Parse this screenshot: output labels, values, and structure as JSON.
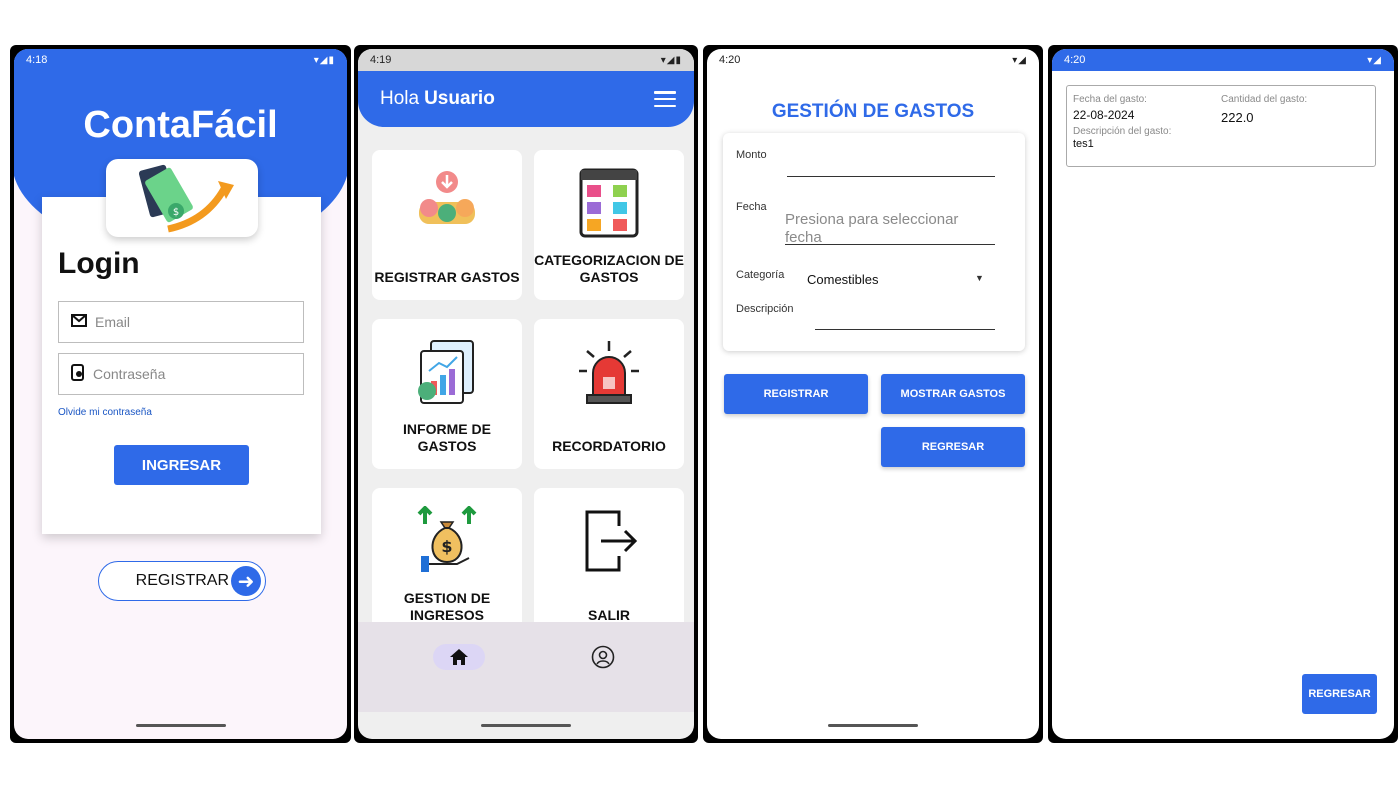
{
  "colors": {
    "primary": "#2f6ae8",
    "background": "#fcf5fb"
  },
  "login_screen": {
    "status_time": "4:18",
    "brand": "ContaFácil",
    "title": "Login",
    "email_placeholder": "Email",
    "password_placeholder": "Contraseña",
    "forgot_password": "Olvide mi contraseña",
    "login_button": "INGRESAR",
    "register_button": "REGISTRAR"
  },
  "menu_screen": {
    "status_time": "4:19",
    "greeting": "Hola",
    "user": "Usuario",
    "tiles": [
      {
        "label": "REGISTRAR GASTOS",
        "icon": "money-coins-icon"
      },
      {
        "label": "CATEGORIZACION DE GASTOS",
        "icon": "categories-board-icon"
      },
      {
        "label": "INFORME DE GASTOS",
        "icon": "report-chart-icon"
      },
      {
        "label": "RECORDATORIO",
        "icon": "alarm-siren-icon"
      },
      {
        "label": "GESTION DE INGRESOS",
        "icon": "money-bag-hand-icon"
      },
      {
        "label": "SALIR",
        "icon": "exit-door-icon"
      }
    ],
    "bottom_nav": [
      "home-icon",
      "profile-icon"
    ]
  },
  "expense_form_screen": {
    "status_time": "4:20",
    "title": "GESTIÓN DE GASTOS",
    "amount_label": "Monto",
    "date_label": "Fecha",
    "date_placeholder": "Presiona para seleccionar fecha",
    "category_label": "Categoría",
    "category_value": "Comestibles",
    "description_label": "Descripción",
    "register_button": "REGISTRAR",
    "show_button": "MOSTRAR GASTOS",
    "back_button": "REGRESAR"
  },
  "expense_list_screen": {
    "status_time": "4:20",
    "items": [
      {
        "date_label": "Fecha del gasto:",
        "date": "22-08-2024",
        "amount_label": "Cantidad del gasto:",
        "amount": "222.0",
        "description_label": "Descripción del gasto:",
        "description": "tes1"
      }
    ],
    "back_button": "REGRESAR"
  }
}
